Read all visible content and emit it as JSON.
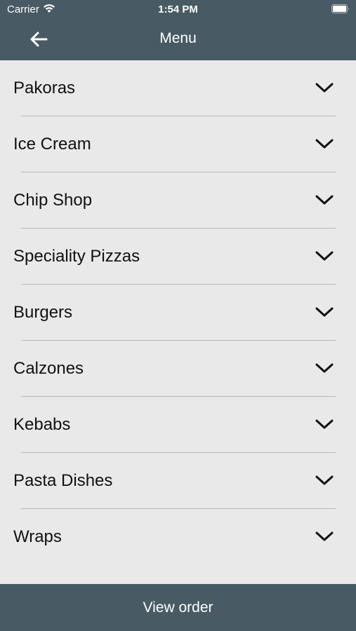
{
  "status_bar": {
    "carrier": "Carrier",
    "time": "1:54 PM",
    "wifi_icon": "wifi-icon",
    "battery_icon": "battery-icon"
  },
  "header": {
    "back_icon": "arrow-left-icon",
    "title": "Menu",
    "background_color": "#485a63"
  },
  "menu": {
    "items": [
      {
        "label": "Pakoras"
      },
      {
        "label": "Ice Cream"
      },
      {
        "label": "Chip Shop"
      },
      {
        "label": "Speciality Pizzas"
      },
      {
        "label": "Burgers"
      },
      {
        "label": "Calzones"
      },
      {
        "label": "Kebabs"
      },
      {
        "label": "Pasta Dishes"
      },
      {
        "label": "Wraps"
      }
    ],
    "expand_icon": "chevron-down-icon"
  },
  "footer": {
    "view_order_label": "View order",
    "background_color": "#485a63"
  }
}
